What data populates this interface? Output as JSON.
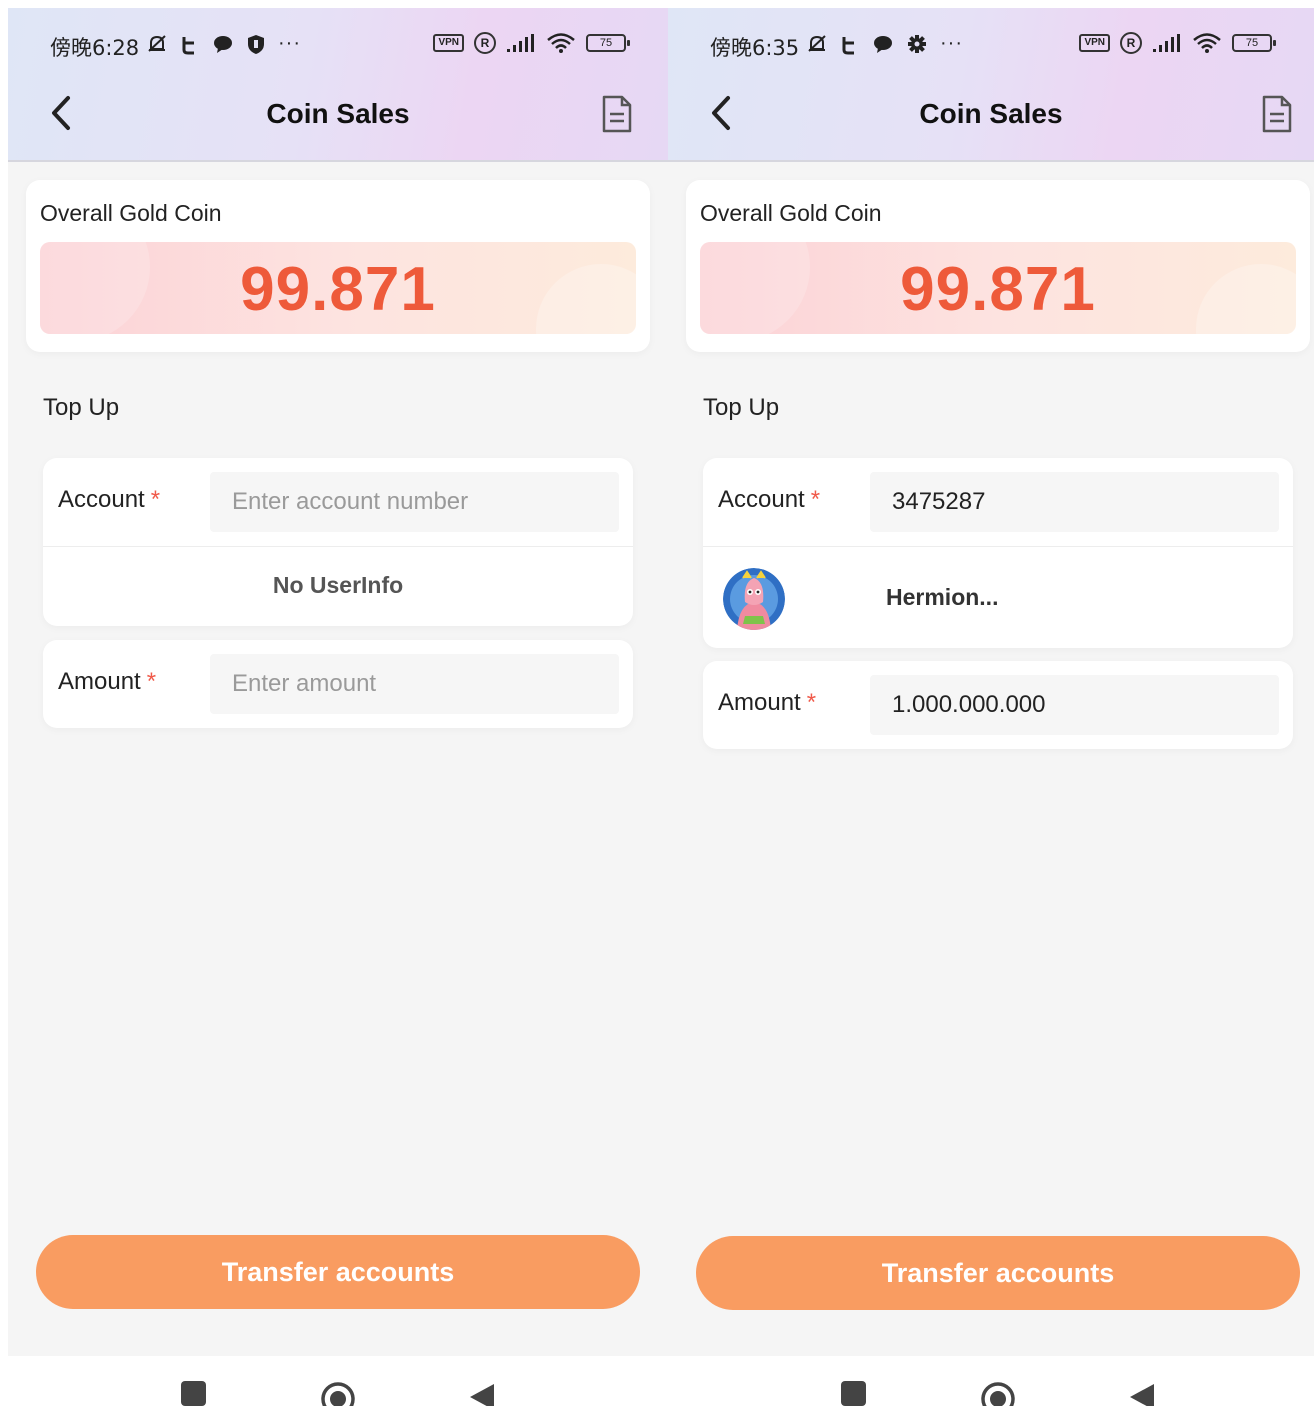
{
  "screens": [
    {
      "status": {
        "time": "傍晚6:28",
        "battery": "75",
        "vpn": "VPN",
        "reg": "R"
      },
      "title": "Coin Sales",
      "coin": {
        "label": "Overall Gold Coin",
        "value": "99.871"
      },
      "section": "Top Up",
      "account": {
        "label": "Account",
        "required": "*",
        "value": "",
        "placeholder": "Enter account number"
      },
      "user": {
        "text": "No UserInfo"
      },
      "amount": {
        "label": "Amount",
        "required": "*",
        "value": "",
        "placeholder": "Enter amount"
      },
      "button": "Transfer accounts",
      "icons": [
        "muted-bell-icon",
        "tiktok-icon",
        "chat-bubble-icon",
        "shield-icon",
        "more-icon",
        "vpn-icon",
        "registered-icon",
        "signal-icon",
        "wifi-icon",
        "battery-icon"
      ]
    },
    {
      "status": {
        "time": "傍晚6:35",
        "battery": "75",
        "vpn": "VPN",
        "reg": "R"
      },
      "title": "Coin Sales",
      "coin": {
        "label": "Overall Gold Coin",
        "value": "99.871"
      },
      "section": "Top Up",
      "account": {
        "label": "Account",
        "required": "*",
        "value": "3475287",
        "placeholder": "Enter account number"
      },
      "user": {
        "name": "Hermion..."
      },
      "amount": {
        "label": "Amount",
        "required": "*",
        "value": "1.000.000.000",
        "placeholder": "Enter amount"
      },
      "button": "Transfer accounts",
      "icons": [
        "muted-bell-icon",
        "tiktok-icon",
        "chat-bubble-icon",
        "gear-icon",
        "more-icon",
        "vpn-icon",
        "registered-icon",
        "signal-icon",
        "wifi-icon",
        "battery-icon"
      ]
    }
  ],
  "colors": {
    "accent": "#f99c61",
    "coin_value": "#ee5a3a",
    "required": "#f05a4a"
  }
}
